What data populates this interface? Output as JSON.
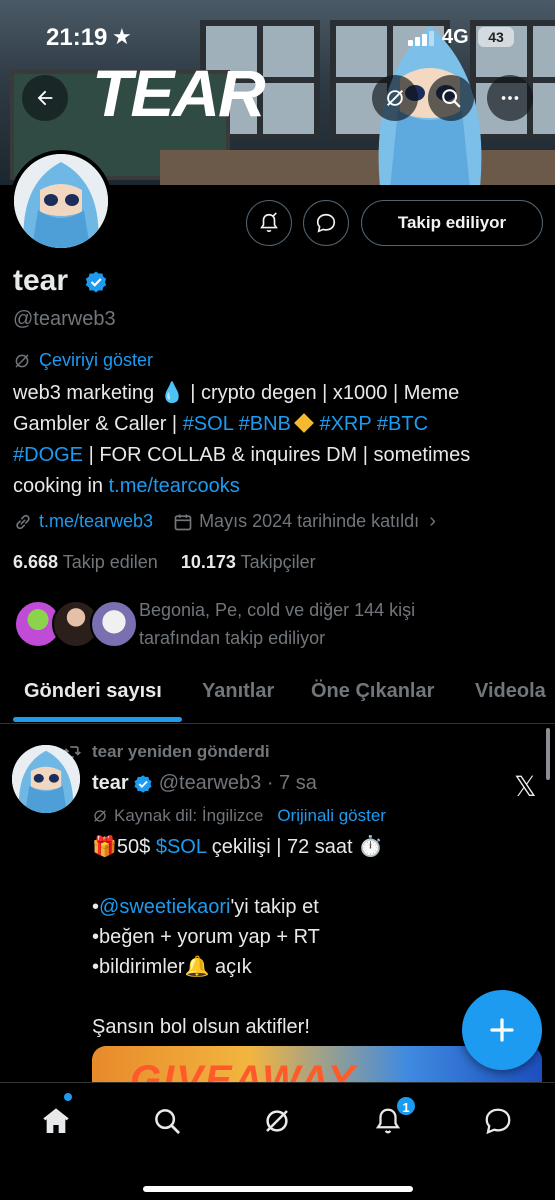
{
  "status_bar": {
    "time": "21:19",
    "network": "4G",
    "battery": "43"
  },
  "banner": {
    "logo_text": "TEAR"
  },
  "profile": {
    "name": "tear",
    "handle": "@tearweb3",
    "follow_button": "Takip ediliyor",
    "translate_link": "Çeviriyi göster",
    "bio": {
      "line1": "web3 marketing 💧 | crypto degen | x1000 | Meme",
      "line2_a": "Gambler & Caller | ",
      "line2_tags": "#SOL #BNB",
      "line2_b": " ",
      "line2_tags2": "#XRP #BTC",
      "line3_tag": "#DOGE",
      "line3_rest": " | FOR COLLAB & inquires DM | sometimes",
      "line4_a": "cooking in ",
      "line4_link": "t.me/tearcooks"
    },
    "website": "t.me/tearweb3",
    "joined": "Mayıs 2024 tarihinde katıldı",
    "following_count": "6.668",
    "following_label": "Takip edilen",
    "followers_count": "10.173",
    "followers_label": "Takipçiler",
    "followed_by_line1": "Begonia, Pe, cold ve diğer 144 kişi",
    "followed_by_line2": "tarafından takip ediliyor"
  },
  "tabs": [
    "Gönderi sayısı",
    "Yanıtlar",
    "Öne Çıkanlar",
    "Videola"
  ],
  "post": {
    "repost_label": "tear yeniden gönderdi",
    "author": "tear",
    "handle_time": "@tearweb3 · 7 sa",
    "source_label": "Kaynak dil: İngilizce",
    "show_original": "Orijinali göster",
    "line1_a": "🎁50$ ",
    "line1_tag": "$SOL",
    "line1_b": " çekilişi | 72 saat ⏱️",
    "line3_a": "•",
    "line3_mention": "@sweetiekaori",
    "line3_b": "'yi takip et",
    "line4": "•beğen + yorum yap + RT",
    "line5": "•bildirimler🔔 açık",
    "line7": "Şansın bol olsun aktifler!",
    "image_text": "GIVEAWAY"
  },
  "nav": {
    "notifications_count": "1"
  },
  "colors": {
    "accent": "#1d9bf0",
    "background": "#000000",
    "muted": "#71767b"
  }
}
